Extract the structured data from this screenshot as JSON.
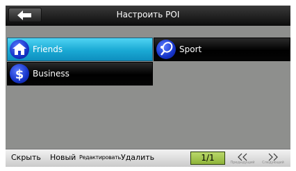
{
  "window": {
    "title": "Настроить POI"
  },
  "categories": [
    {
      "label": "Friends",
      "icon": "house-icon",
      "selected": true
    },
    {
      "label": "Sport",
      "icon": "tennis-racket-icon",
      "selected": false
    },
    {
      "label": "Business",
      "icon": "dollar-icon",
      "selected": false
    }
  ],
  "toolbar": {
    "hide_label": "Скрыть",
    "new_label": "Новый",
    "edit_label": "Редактировать",
    "delete_label": "Удалить",
    "page_indicator": "1/1",
    "prev_label": "Предыдущий",
    "next_label": "Следующий"
  },
  "colors": {
    "selected_row": "#1aa9d4",
    "row_background": "#000000",
    "panel_background": "#8e8f8d",
    "pager_background": "#a7c853"
  }
}
